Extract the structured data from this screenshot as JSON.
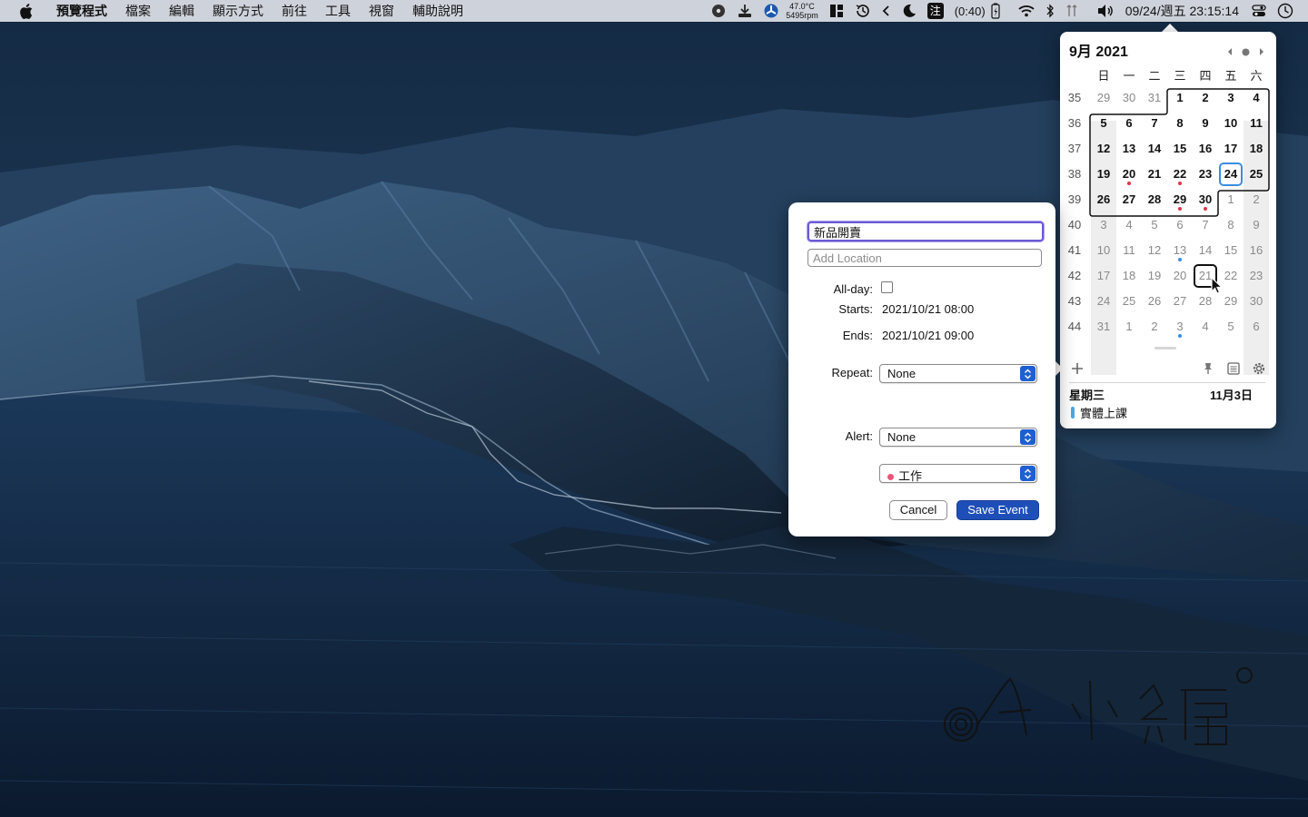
{
  "menubar": {
    "app_name": "預覽程式",
    "menus": [
      "檔案",
      "編輯",
      "顯示方式",
      "前往",
      "工具",
      "視窗",
      "輔助說明"
    ],
    "temp_top": "47.0°C",
    "temp_bottom": "5495rpm",
    "battery_time": "(0:40)",
    "clock": "09/24/週五 23:15:14",
    "input_method": "注"
  },
  "calendar": {
    "title": "9月 2021",
    "weekday_headers": [
      "日",
      "一",
      "二",
      "三",
      "四",
      "五",
      "六"
    ],
    "weeks": [
      {
        "num": "35",
        "days": [
          "29",
          "30",
          "31",
          "1",
          "2",
          "3",
          "4"
        ]
      },
      {
        "num": "36",
        "days": [
          "5",
          "6",
          "7",
          "8",
          "9",
          "10",
          "11"
        ]
      },
      {
        "num": "37",
        "days": [
          "12",
          "13",
          "14",
          "15",
          "16",
          "17",
          "18"
        ]
      },
      {
        "num": "38",
        "days": [
          "19",
          "20",
          "21",
          "22",
          "23",
          "24",
          "25"
        ]
      },
      {
        "num": "39",
        "days": [
          "26",
          "27",
          "28",
          "29",
          "30",
          "1",
          "2"
        ]
      },
      {
        "num": "40",
        "days": [
          "3",
          "4",
          "5",
          "6",
          "7",
          "8",
          "9"
        ]
      },
      {
        "num": "41",
        "days": [
          "10",
          "11",
          "12",
          "13",
          "14",
          "15",
          "16"
        ]
      },
      {
        "num": "42",
        "days": [
          "17",
          "18",
          "19",
          "20",
          "21",
          "22",
          "23"
        ]
      },
      {
        "num": "43",
        "days": [
          "24",
          "25",
          "26",
          "27",
          "28",
          "29",
          "30"
        ]
      },
      {
        "num": "44",
        "days": [
          "31",
          "1",
          "2",
          "3",
          "4",
          "5",
          "6"
        ]
      }
    ],
    "event_day_label": "星期三",
    "event_date_label": "11月3日",
    "events": [
      {
        "title": "實體上課",
        "color": "#4da8e8"
      }
    ],
    "colors": {
      "today_ring": "#3a8de0",
      "event_dot_red": "#e0344a",
      "event_dot_blue": "#3a8de0"
    }
  },
  "dialog": {
    "title_value": "新品開賣",
    "location_placeholder": "Add Location",
    "allday_label": "All-day:",
    "allday_checked": false,
    "starts_label": "Starts:",
    "starts_value": "2021/10/21 08:00",
    "ends_label": "Ends:",
    "ends_value": "2021/10/21 09:00",
    "repeat_label": "Repeat:",
    "repeat_value": "None",
    "alert_label": "Alert:",
    "alert_value": "None",
    "calendar_value": "工作",
    "calendar_color": "#e8577a",
    "cancel_label": "Cancel",
    "save_label": "Save Event",
    "accent_color": "#1e4fb8"
  },
  "icons": [
    "apple-logo-icon",
    "music-icon",
    "download-icon",
    "fan-temperature-icon",
    "layout-icon",
    "time-machine-icon",
    "chevron-left-icon",
    "moon-icon",
    "input-method-icon",
    "battery-icon",
    "wifi-icon",
    "bluetooth-icon",
    "network-icon",
    "volume-icon",
    "control-center-icon",
    "clock-icon",
    "add-icon",
    "pin-icon",
    "list-icon",
    "gear-icon",
    "prev-month-icon",
    "today-dot-icon",
    "next-month-icon"
  ]
}
